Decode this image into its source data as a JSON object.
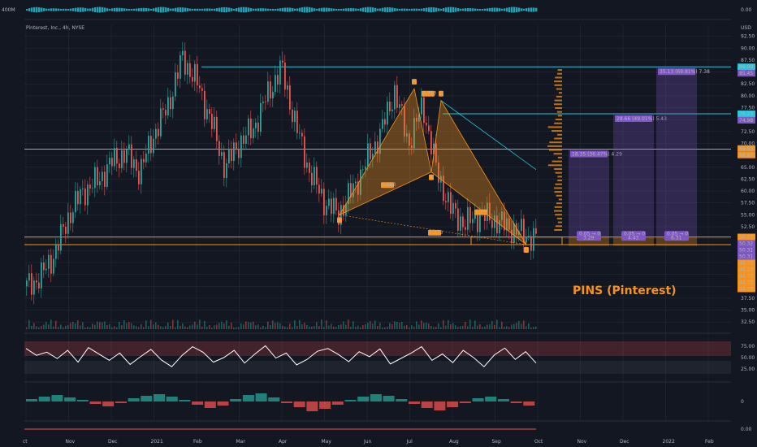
{
  "header": {
    "symbol_line": "Pinterest, Inc., 4h, NYSE",
    "currency": "USD",
    "top_indicator_label": "400M",
    "top_indicator_value": "0.00"
  },
  "annotation_title": "PINS (Pinterest)",
  "colors": {
    "background": "#131722",
    "up": "#26a69a",
    "down": "#ef5350",
    "orange": "#f7931a",
    "cyan": "#26c6da",
    "purple": "#7e57c2",
    "white": "#ffffff",
    "grid": "#2a2e39"
  },
  "chart_data": [
    {
      "type": "line",
      "name": "price",
      "title": "Pinterest, Inc., 4h, NYSE",
      "x_ticks": [
        "Oct",
        "Nov",
        "Dec",
        "2021",
        "Feb",
        "Mar",
        "Apr",
        "May",
        "Jun",
        "Jul",
        "Aug",
        "Sep",
        "Oct",
        "Nov",
        "Dec",
        "2022",
        "Feb"
      ],
      "y_ticks": [
        92.5,
        90.0,
        87.5,
        85.0,
        82.5,
        80.0,
        77.5,
        75.0,
        72.5,
        70.0,
        67.5,
        65.0,
        62.5,
        60.0,
        57.5,
        55.0,
        52.5,
        50.0,
        47.5,
        45.0,
        42.5,
        40.0,
        37.5,
        35.0,
        32.5
      ],
      "ylim": [
        31,
        95
      ],
      "x": [
        "Oct",
        "Oct",
        "Nov",
        "Nov",
        "Nov",
        "Dec",
        "Dec",
        "Dec",
        "2021",
        "2021",
        "Feb",
        "Feb",
        "Feb",
        "Feb",
        "Mar",
        "Mar",
        "Mar",
        "Apr",
        "Apr",
        "Apr",
        "Apr",
        "May",
        "May",
        "Jun",
        "Jun",
        "Jun",
        "Jul",
        "Jul",
        "Jul",
        "Jul",
        "Aug",
        "Aug",
        "Aug",
        "Sep",
        "Sep",
        "Sep",
        "Sep"
      ],
      "y": [
        40,
        42,
        47,
        55,
        60,
        62,
        66,
        68,
        64,
        72,
        78,
        88,
        83,
        75,
        65,
        70,
        73,
        80,
        86,
        74,
        64,
        58,
        55,
        60,
        66,
        72,
        81,
        70,
        78,
        64,
        56,
        53,
        55,
        54,
        52.5,
        51,
        50
      ],
      "price_labels": [
        {
          "value": "86.09",
          "color": "#26c6da"
        },
        {
          "value": "85.45",
          "color": "#7e57c2"
        },
        {
          "value": "76.23",
          "color": "#26c6da"
        },
        {
          "value": "74.98",
          "color": "#7e57c2"
        },
        {
          "value": "68.93",
          "color": "#f7931a"
        },
        {
          "value": "68.67",
          "color": "#f7931a"
        },
        {
          "value": "50.37",
          "color": "#f7931a"
        },
        {
          "value": "50.32",
          "color": "#7e57c2"
        },
        {
          "value": "50.31",
          "color": "#7e57c2"
        },
        {
          "value": "50.31",
          "color": "#7e57c2"
        },
        {
          "value": "48.75",
          "color": "#f7931a"
        },
        {
          "value": "46.23",
          "color": "#f7931a"
        },
        {
          "value": "44.75",
          "color": "#f7931a"
        },
        {
          "value": "44.75",
          "color": "#f7931a"
        },
        {
          "value": "44.75",
          "color": "#f7931a"
        }
      ],
      "horizontal_levels": [
        {
          "value": 86.09,
          "color": "#26c6da"
        },
        {
          "value": 76.23,
          "color": "#26c6da"
        },
        {
          "value": 68.8,
          "color": "#f7931a"
        },
        {
          "value": 50.35,
          "color": "#f7931a"
        },
        {
          "value": 48.75,
          "color": "#f7931a"
        }
      ],
      "pattern_points": [
        {
          "label": "X",
          "x_tick": "May",
          "value": 55.0
        },
        {
          "label": "A",
          "x_tick": "Jul",
          "value": 81.5
        },
        {
          "label": "B",
          "x_tick": "Jul",
          "value": 64.0
        },
        {
          "label": "C",
          "x_tick": "Jul",
          "value": 79.0
        },
        {
          "label": "D",
          "x_tick": "Oct",
          "value": 48.75
        }
      ],
      "pattern_ratios": [
        "0.563",
        "0.753",
        "1.2**",
        "1.273"
      ],
      "measure_boxes": [
        {
          "label": "18.35 (36.47%) 4.29",
          "bottom": "0.05 → 0",
          "bottom2": "3.29",
          "top_value": 68.8
        },
        {
          "label": "28.66 (49.01%) 5.43",
          "bottom": "0.05 → 0",
          "bottom2": "4.43",
          "top_value": 76.23
        },
        {
          "label": "35.13 (69.81%) 7.38",
          "bottom": "0.05 → 0",
          "bottom2": "6.31",
          "top_value": 86.09
        }
      ],
      "grid": true
    },
    {
      "type": "line",
      "name": "oscillator",
      "y_ticks": [
        75.0,
        50.0,
        25.0
      ],
      "ylim": [
        0,
        100
      ],
      "values": [
        70,
        55,
        62,
        48,
        66,
        40,
        72,
        58,
        44,
        60,
        35,
        52,
        68,
        45,
        30,
        55,
        74,
        62,
        40,
        50,
        66,
        38,
        58,
        76,
        49,
        60,
        34,
        46,
        64,
        70,
        57,
        41,
        63,
        52,
        69,
        36,
        48,
        60,
        74,
        44,
        58,
        39,
        66,
        50,
        30,
        56,
        71,
        46,
        63,
        38
      ]
    },
    {
      "type": "bar",
      "name": "histogram",
      "y_ticks": [
        0
      ],
      "ylim": [
        -2,
        2
      ],
      "values": [
        0.3,
        0.6,
        0.8,
        0.5,
        0.2,
        -0.3,
        -0.6,
        -0.2,
        0.4,
        0.7,
        0.9,
        0.6,
        0.2,
        -0.4,
        -0.8,
        -0.5,
        0.3,
        0.8,
        1.0,
        0.5,
        -0.2,
        -0.7,
        -1.2,
        -0.9,
        -0.4,
        0.2,
        0.6,
        0.9,
        0.7,
        0.3,
        -0.3,
        -0.8,
        -1.1,
        -0.7,
        -0.2,
        0.4,
        0.6,
        0.3,
        -0.2,
        -0.5
      ]
    }
  ],
  "bottom_indicator_value": "0.00",
  "x_axis_labels": [
    "ct",
    "Nov",
    "Dec",
    "2021",
    "Feb",
    "Mar",
    "Apr",
    "May",
    "Jun",
    "Jul",
    "Aug",
    "Sep",
    "Oct",
    "Nov",
    "Dec",
    "2022",
    "Feb"
  ]
}
